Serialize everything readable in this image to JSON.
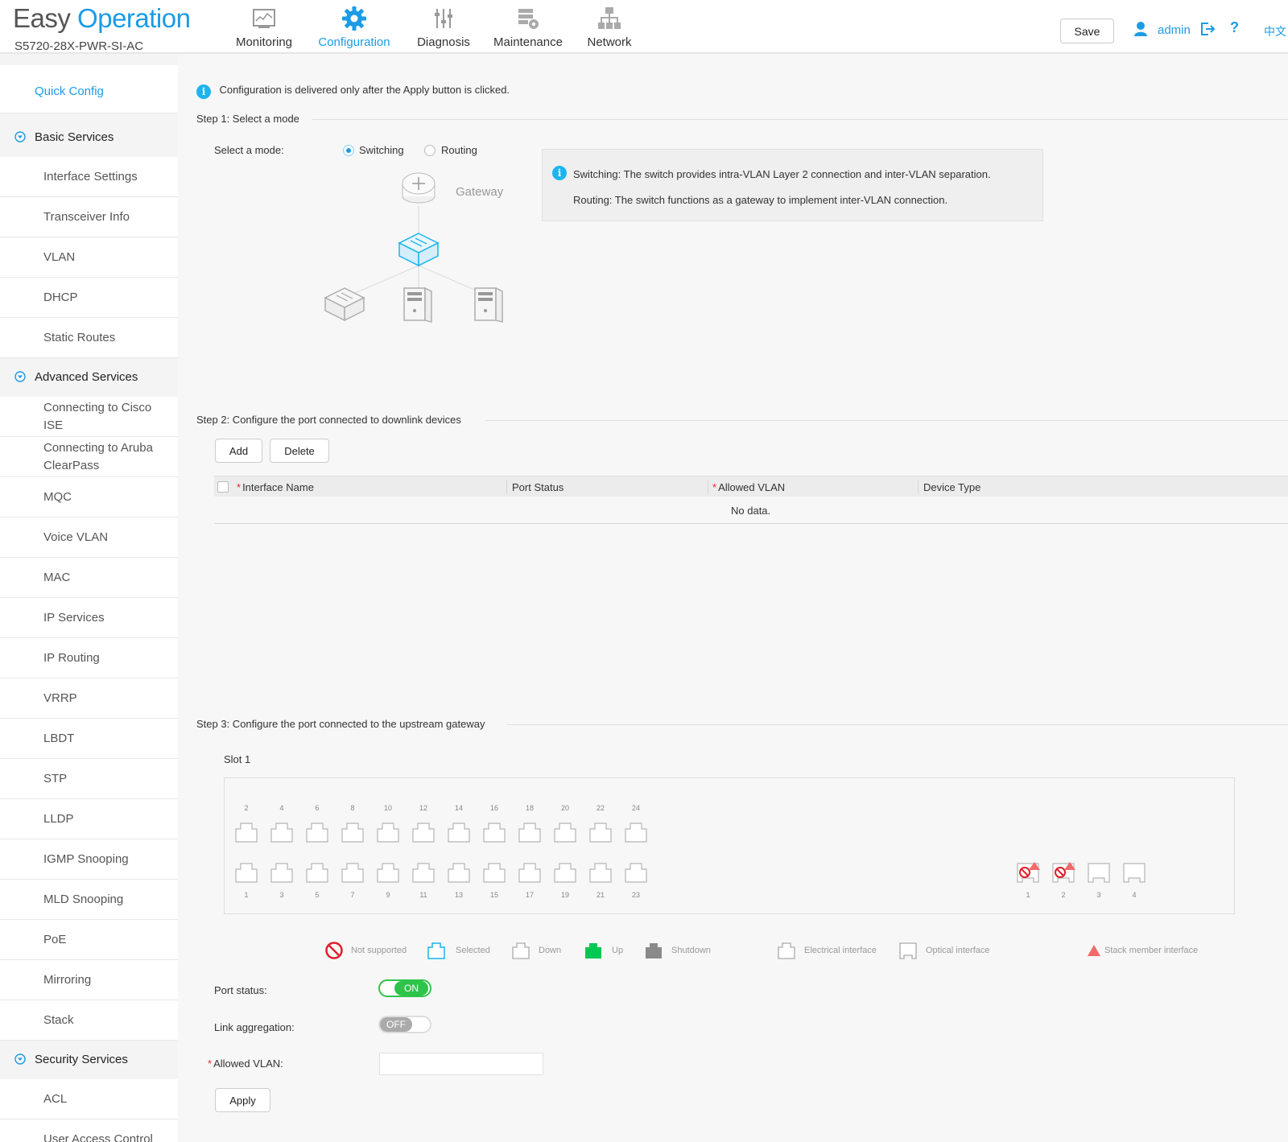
{
  "header": {
    "logo_easy": "Easy",
    "logo_operation": "Operation",
    "model": "S5720-28X-PWR-SI-AC",
    "nav": [
      {
        "label": "Monitoring",
        "icon": "monitoring-icon"
      },
      {
        "label": "Configuration",
        "icon": "gear-icon",
        "active": true
      },
      {
        "label": "Diagnosis",
        "icon": "sliders-icon"
      },
      {
        "label": "Maintenance",
        "icon": "maintenance-icon"
      },
      {
        "label": "Network",
        "icon": "network-topology-icon"
      }
    ],
    "save_label": "Save",
    "username": "admin",
    "help": "?",
    "language": "中文"
  },
  "sidebar": {
    "quick_config": "Quick Config",
    "groups": [
      {
        "label": "Basic Services",
        "items": [
          "Interface Settings",
          "Transceiver Info",
          "VLAN",
          "DHCP",
          "Static Routes"
        ]
      },
      {
        "label": "Advanced Services",
        "items": [
          "Connecting to Cisco ISE",
          "Connecting to Aruba ClearPass",
          "MQC",
          "Voice VLAN",
          "MAC",
          "IP Services",
          "IP Routing",
          "VRRP",
          "LBDT",
          "STP",
          "LLDP",
          "IGMP Snooping",
          "MLD Snooping",
          "PoE",
          "Mirroring",
          "Stack"
        ]
      },
      {
        "label": "Security Services",
        "items": [
          "ACL",
          "User Access Control"
        ]
      }
    ]
  },
  "main": {
    "notice": "Configuration is delivered only after the Apply button is clicked.",
    "step1": {
      "title": "Step 1: Select a mode",
      "mode_label": "Select a mode:",
      "options": [
        "Switching",
        "Routing"
      ],
      "selected": "Switching",
      "gateway_label": "Gateway",
      "tip_switching": "Switching: The switch provides intra-VLAN Layer 2 connection and inter-VLAN separation.",
      "tip_routing": "Routing: The switch functions as a gateway to implement inter-VLAN connection."
    },
    "step2": {
      "title": "Step 2: Configure the port connected to downlink devices",
      "add_label": "Add",
      "delete_label": "Delete",
      "columns": [
        {
          "label": "Interface Name",
          "required": true
        },
        {
          "label": "Port Status",
          "required": false
        },
        {
          "label": "Allowed VLAN",
          "required": true
        },
        {
          "label": "Device Type",
          "required": false
        }
      ],
      "empty_text": "No data."
    },
    "step3": {
      "title": "Step 3: Configure the port connected to the upstream gateway",
      "slot_label": "Slot 1",
      "top_ports": [
        "2",
        "4",
        "6",
        "8",
        "10",
        "12",
        "14",
        "16",
        "18",
        "20",
        "22",
        "24"
      ],
      "bottom_ports": [
        "1",
        "3",
        "5",
        "7",
        "9",
        "11",
        "13",
        "15",
        "17",
        "19",
        "21",
        "23"
      ],
      "uplink_ports": [
        {
          "num": "1",
          "not_supported": true,
          "stack_member": true
        },
        {
          "num": "2",
          "not_supported": true,
          "stack_member": true
        },
        {
          "num": "3",
          "not_supported": false,
          "stack_member": false
        },
        {
          "num": "4",
          "not_supported": false,
          "stack_member": false
        }
      ],
      "legend": [
        "Not supported",
        "Selected",
        "Down",
        "Up",
        "Shutdown",
        "Electrical interface",
        "Optical interface",
        "Stack member interface"
      ],
      "port_status_label": "Port status:",
      "port_status_value": "ON",
      "link_agg_label": "Link aggregation:",
      "link_agg_value": "OFF",
      "allowed_vlan_label": "Allowed VLAN:",
      "allowed_vlan_value": "",
      "apply_label": "Apply"
    },
    "colors": {
      "accent": "#1c9be6",
      "up": "#00c853",
      "shutdown": "#8a8a8a",
      "not_supported": "#e0202a",
      "stack": "#f26a6a",
      "toggle_on": "#2ec44a"
    }
  }
}
